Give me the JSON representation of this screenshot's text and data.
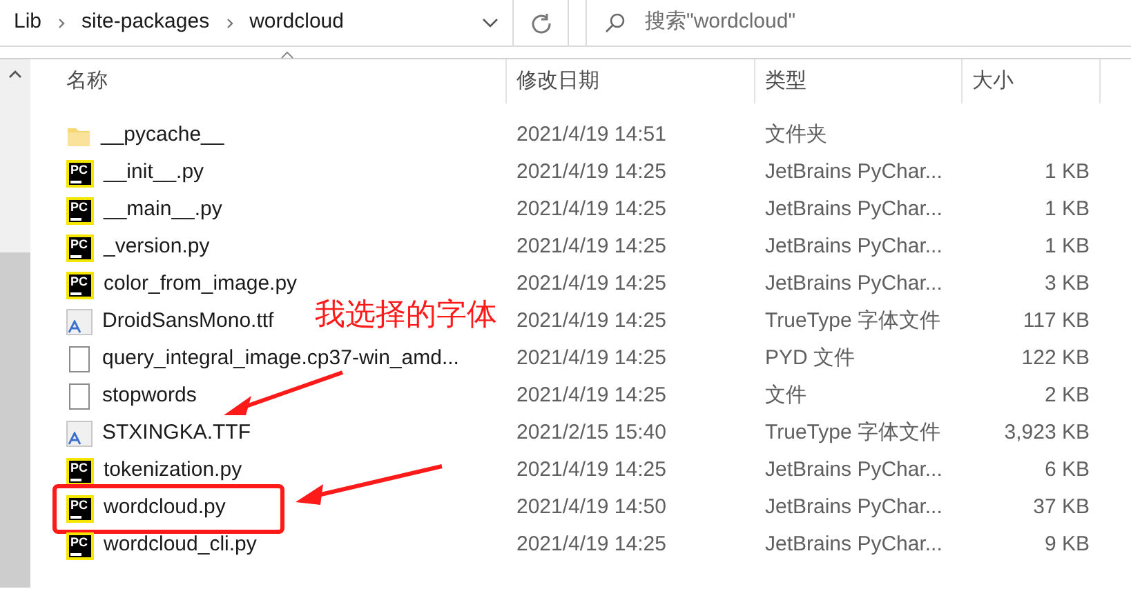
{
  "address_bar": {
    "crumbs": [
      "Lib",
      "site-packages",
      "wordcloud"
    ]
  },
  "search": {
    "placeholder": "搜索\"wordcloud\""
  },
  "columns": [
    "名称",
    "修改日期",
    "类型",
    "大小"
  ],
  "files": [
    {
      "kind": "folder",
      "name": "__pycache__",
      "date": "2021/4/19 14:51",
      "type": "文件夹",
      "highlighted": false
    },
    {
      "kind": "pycharm",
      "icon_label": "PC",
      "name": "__init__.py",
      "date": "2021/4/19 14:25",
      "type": "JetBrains PyChar...",
      "size": "1 KB",
      "highlighted": false
    },
    {
      "kind": "pycharm",
      "icon_label": "PC",
      "name": "__main__.py",
      "date": "2021/4/19 14:25",
      "type": "JetBrains PyChar...",
      "size": "1 KB",
      "highlighted": false
    },
    {
      "kind": "pycharm",
      "icon_label": "PC",
      "name": "_version.py",
      "date": "2021/4/19 14:25",
      "type": "JetBrains PyChar...",
      "size": "1 KB",
      "highlighted": false
    },
    {
      "kind": "pycharm",
      "icon_label": "PC",
      "name": "color_from_image.py",
      "date": "2021/4/19 14:25",
      "type": "JetBrains PyChar...",
      "size": "3 KB",
      "highlighted": false
    },
    {
      "kind": "font",
      "name": "DroidSansMono.ttf",
      "date": "2021/4/19 14:25",
      "type": "TrueType 字体文件",
      "size": "117 KB",
      "highlighted": false
    },
    {
      "kind": "file",
      "name": "query_integral_image.cp37-win_amd...",
      "date": "2021/4/19 14:25",
      "type": "PYD 文件",
      "size": "122 KB",
      "highlighted": false
    },
    {
      "kind": "file",
      "name": "stopwords",
      "date": "2021/4/19 14:25",
      "type": "文件",
      "size": "2 KB",
      "highlighted": false
    },
    {
      "kind": "font",
      "name": "STXINGKA.TTF",
      "date": "2021/2/15 15:40",
      "type": "TrueType 字体文件",
      "size": "3,923 KB",
      "highlighted": false
    },
    {
      "kind": "pycharm",
      "icon_label": "PC",
      "name": "tokenization.py",
      "date": "2021/4/19 14:25",
      "type": "JetBrains PyChar...",
      "size": "6 KB",
      "highlighted": false
    },
    {
      "kind": "pycharm",
      "icon_label": "PC",
      "name": "wordcloud.py",
      "date": "2021/4/19 14:50",
      "type": "JetBrains PyChar...",
      "size": "37 KB",
      "highlighted": true
    },
    {
      "kind": "pycharm",
      "icon_label": "PC",
      "name": "wordcloud_cli.py",
      "date": "2021/4/19 14:25",
      "type": "JetBrains PyChar...",
      "size": "9 KB",
      "highlighted": false
    }
  ],
  "annotation": {
    "text": "我选择的字体"
  }
}
